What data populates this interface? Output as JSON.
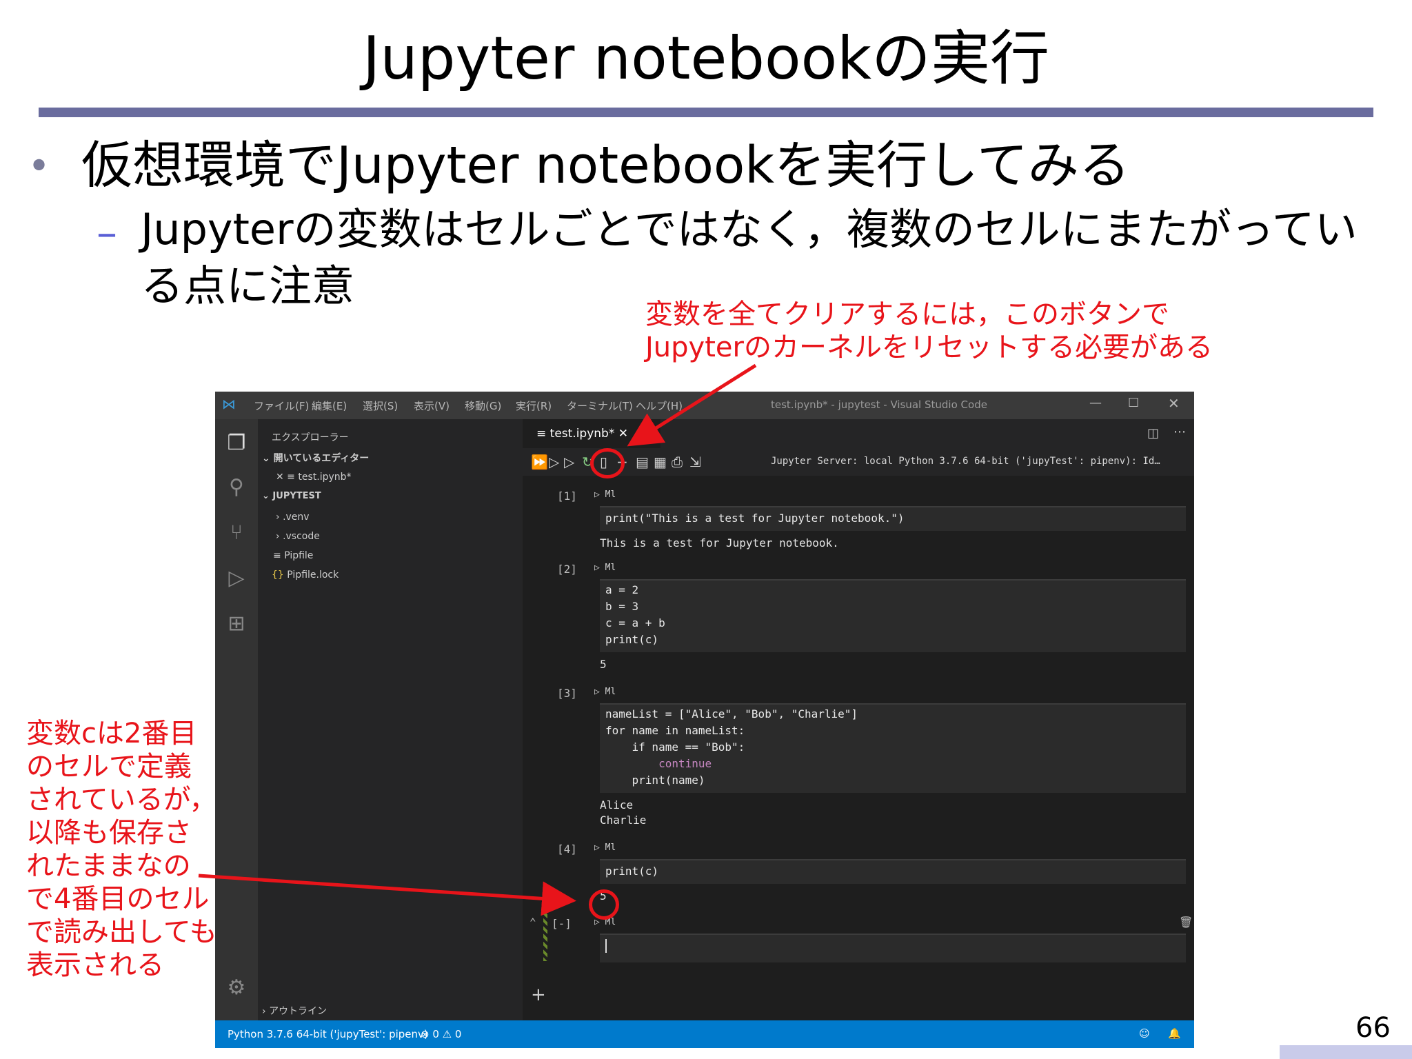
{
  "slide": {
    "title": "Jupyter notebookの実行",
    "bullet1": "仮想環境でJupyter notebookを実行してみる",
    "bullet2": "Jupyterの変数はセルごとではなく，複数のセルにまたがっている点に注意",
    "bullet_marker": "•",
    "dash_marker": "–",
    "callout_top": "変数を全てクリアするには，このボタンで\nJupyterのカーネルをリセットする必要がある",
    "callout_left": "変数cは2番目\nのセルで定義\nされているが，\n以降も保存さ\nれたままなの\nで4番目のセル\nで読み出しても\n表示される",
    "page_number": "66"
  },
  "vscode": {
    "menu": [
      "ファイル(F)",
      "編集(E)",
      "選択(S)",
      "表示(V)",
      "移動(G)",
      "実行(R)",
      "ターミナル(T)",
      "ヘルプ(H)"
    ],
    "window_title": "test.ipynb* - jupytest - Visual Studio Code",
    "sidebar": {
      "header": "エクスプローラー",
      "open_editors": "開いているエディター",
      "open_file": "test.ipynb*",
      "project": "JUPYTEST",
      "items": [
        ".venv",
        ".vscode",
        "Pipfile",
        "Pipfile.lock"
      ],
      "outline": "アウトライン"
    },
    "tab_label": "test.ipynb*",
    "server_status": "Jupyter Server: local   Python 3.7.6 64-bit ('jupyTest': pipenv): Id…",
    "cells": [
      {
        "num": "[1]",
        "code": [
          "print(\"This is a test for Jupyter notebook.\")"
        ],
        "output": [
          "This is a test for Jupyter notebook."
        ]
      },
      {
        "num": "[2]",
        "code": [
          "a = 2",
          "b = 3",
          "c = a + b",
          "print(c)"
        ],
        "output": [
          "5"
        ]
      },
      {
        "num": "[3]",
        "code": [
          "nameList = [\"Alice\", \"Bob\", \"Charlie\"]",
          "for name in nameList:",
          "    if name == \"Bob\":",
          "        continue",
          "    print(name)"
        ],
        "output": [
          "Alice",
          "Charlie"
        ]
      },
      {
        "num": "[4]",
        "code": [
          "print(c)"
        ],
        "output": [
          "5"
        ]
      },
      {
        "num": "[-]",
        "code": [
          ""
        ],
        "output": []
      }
    ],
    "md_label": "Ml",
    "status_left": "Python 3.7.6 64-bit ('jupyTest': pipenv)",
    "status_problems": "⊗ 0 ⚠ 0",
    "accent_color": "#007acc"
  }
}
